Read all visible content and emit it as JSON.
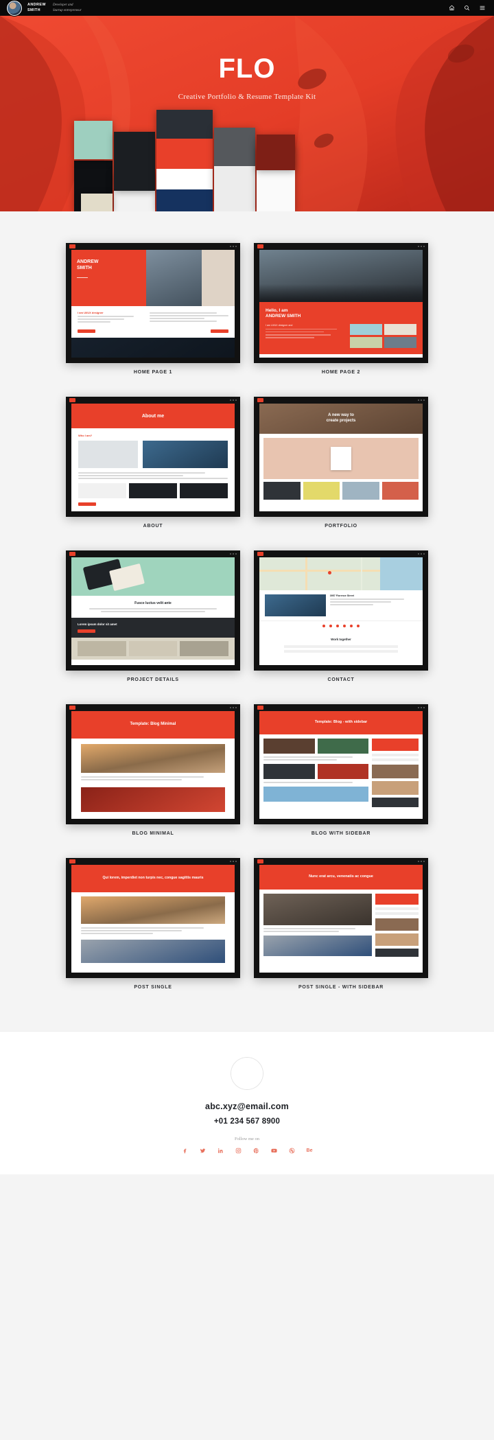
{
  "topbar": {
    "brand_name_line1": "ANDREW",
    "brand_name_line2": "SMITH",
    "brand_tagline_line1": "Developer and",
    "brand_tagline_line2": "Startup entrepreneur",
    "icons": [
      "home-icon",
      "search-icon",
      "menu-icon"
    ]
  },
  "hero": {
    "title": "FLO",
    "subtitle": "Creative Portfolio & Resume Template Kit",
    "background_color": "#e8402a"
  },
  "grid": {
    "items": [
      {
        "label": "HOME PAGE 1",
        "style": "home1"
      },
      {
        "label": "HOME PAGE 2",
        "style": "home2"
      },
      {
        "label": "ABOUT",
        "style": "about"
      },
      {
        "label": "PORTFOLIO",
        "style": "portfolio"
      },
      {
        "label": "PROJECT DETAILS",
        "style": "project"
      },
      {
        "label": "CONTACT",
        "style": "contact"
      },
      {
        "label": "BLOG MINIMAL",
        "style": "blogmin",
        "inner_title": "Template: Blog Minimal"
      },
      {
        "label": "BLOG WITH SIDEBAR",
        "style": "blogside",
        "inner_title": "Template: Blog - with sidebar"
      },
      {
        "label": "POST SINGLE",
        "style": "post1",
        "inner_title": "Qui lorem, imperdiet non turpis nec, congue sagittis mauris"
      },
      {
        "label": "POST SINGLE - WITH SIDEBAR",
        "style": "post2",
        "inner_title": "Nunc erat arcu, venenatis ac congue"
      }
    ]
  },
  "footer": {
    "email": "abc.xyz@email.com",
    "phone": "+01 234 567 8900",
    "follow_label": "Follow me on",
    "socials": [
      {
        "name": "facebook-icon",
        "glyph": "f"
      },
      {
        "name": "twitter-icon",
        "glyph": "t"
      },
      {
        "name": "linkedin-icon",
        "glyph": "in"
      },
      {
        "name": "instagram-icon",
        "glyph": "ig"
      },
      {
        "name": "pinterest-icon",
        "glyph": "p"
      },
      {
        "name": "youtube-icon",
        "glyph": "yt"
      },
      {
        "name": "dribbble-icon",
        "glyph": "db"
      },
      {
        "name": "behance-icon",
        "glyph": "Be"
      }
    ],
    "accent_color": "#e8715d"
  }
}
